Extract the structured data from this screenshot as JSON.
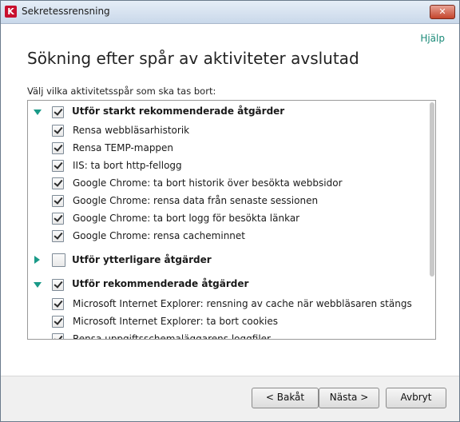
{
  "window": {
    "title": "Sekretessrensning",
    "app_icon": "K",
    "close_label": "✕",
    "help_label": "Hjälp"
  },
  "main": {
    "heading": "Sökning efter spår av aktiviteter avslutad",
    "instruction": "Välj vilka aktivitetsspår som ska tas bort:"
  },
  "groups": {
    "strong": {
      "label": "Utför starkt rekommenderade åtgärder",
      "checked": true,
      "expanded": true,
      "items": [
        "Rensa webbläsarhistorik",
        "Rensa TEMP-mappen",
        "IIS: ta bort http-fellogg",
        "Google Chrome: ta bort historik över besökta webbsidor",
        "Google Chrome: rensa data från senaste sessionen",
        "Google Chrome: ta bort logg för besökta länkar",
        "Google Chrome: rensa cacheminnet"
      ]
    },
    "additional": {
      "label": "Utför ytterligare åtgärder",
      "checked": false,
      "expanded": false
    },
    "recommended": {
      "label": "Utför rekommenderade åtgärder",
      "checked": true,
      "expanded": true,
      "items": [
        "Microsoft Internet Explorer: rensning av cache när webbläsaren stängs",
        "Microsoft Internet Explorer: ta bort cookies",
        "Rensa uppgiftsschemaläggarens loggfiler"
      ]
    }
  },
  "buttons": {
    "back": "< Bakåt",
    "next": "Nästa >",
    "cancel": "Avbryt"
  },
  "colors": {
    "accent": "#1a9a88",
    "close": "#c4452c"
  }
}
